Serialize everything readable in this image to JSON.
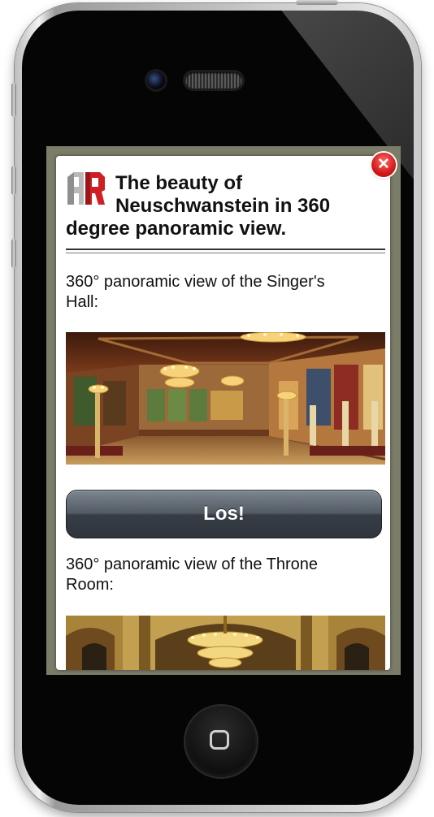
{
  "dialog": {
    "title_line1": "The beauty of",
    "title_line2": "Neuschwanstein in 360",
    "title_line3": "degree panoramic view.",
    "close_icon": "close-icon",
    "logo_icon": "ar-logo-icon"
  },
  "sections": [
    {
      "caption_line1": "360° panoramic view of the Singer's",
      "caption_line2": "Hall:",
      "image": "singers-hall-panorama"
    },
    {
      "caption_line1": "360° panoramic view of the Throne",
      "caption_line2": "Room:",
      "image": "throne-room-panorama"
    }
  ],
  "los_button": {
    "label": "Los!"
  },
  "colors": {
    "accent_red": "#d31a1a",
    "button_dark": "#363d45",
    "backdrop": "#7b7d68"
  }
}
